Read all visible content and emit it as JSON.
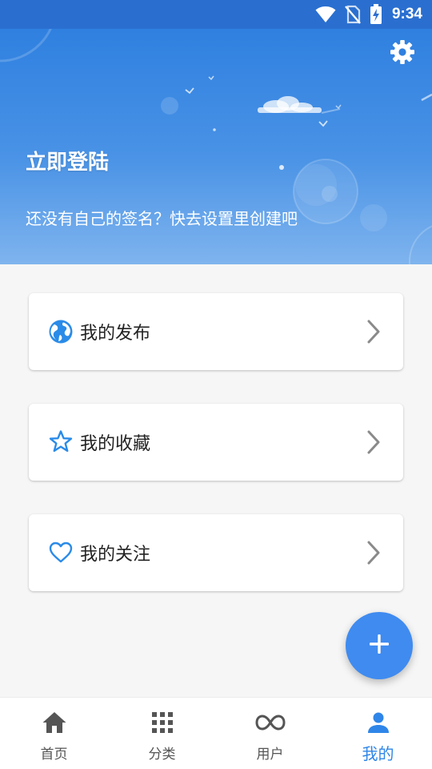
{
  "status_bar": {
    "time": "9:34",
    "icons": [
      "wifi-icon",
      "no-sim-icon",
      "battery-charging-icon"
    ]
  },
  "header": {
    "login_title": "立即登陆",
    "signature": "还没有自己的签名？快去设置里创建吧",
    "settings_icon": "gear-icon"
  },
  "menu": [
    {
      "label": "我的发布",
      "icon": "globe-icon"
    },
    {
      "label": "我的收藏",
      "icon": "star-outline-icon"
    },
    {
      "label": "我的关注",
      "icon": "heart-outline-icon"
    }
  ],
  "fab": {
    "icon": "plus-icon"
  },
  "bottom_nav": [
    {
      "label": "首页",
      "icon": "home-icon",
      "active": false
    },
    {
      "label": "分类",
      "icon": "grid-icon",
      "active": false
    },
    {
      "label": "用户",
      "icon": "infinity-icon",
      "active": false
    },
    {
      "label": "我的",
      "icon": "person-icon",
      "active": true
    }
  ],
  "colors": {
    "accent": "#2f86e8",
    "header_top": "#2f80e0",
    "fab": "#3f8bf0",
    "icon_blue": "#2a8be8"
  }
}
